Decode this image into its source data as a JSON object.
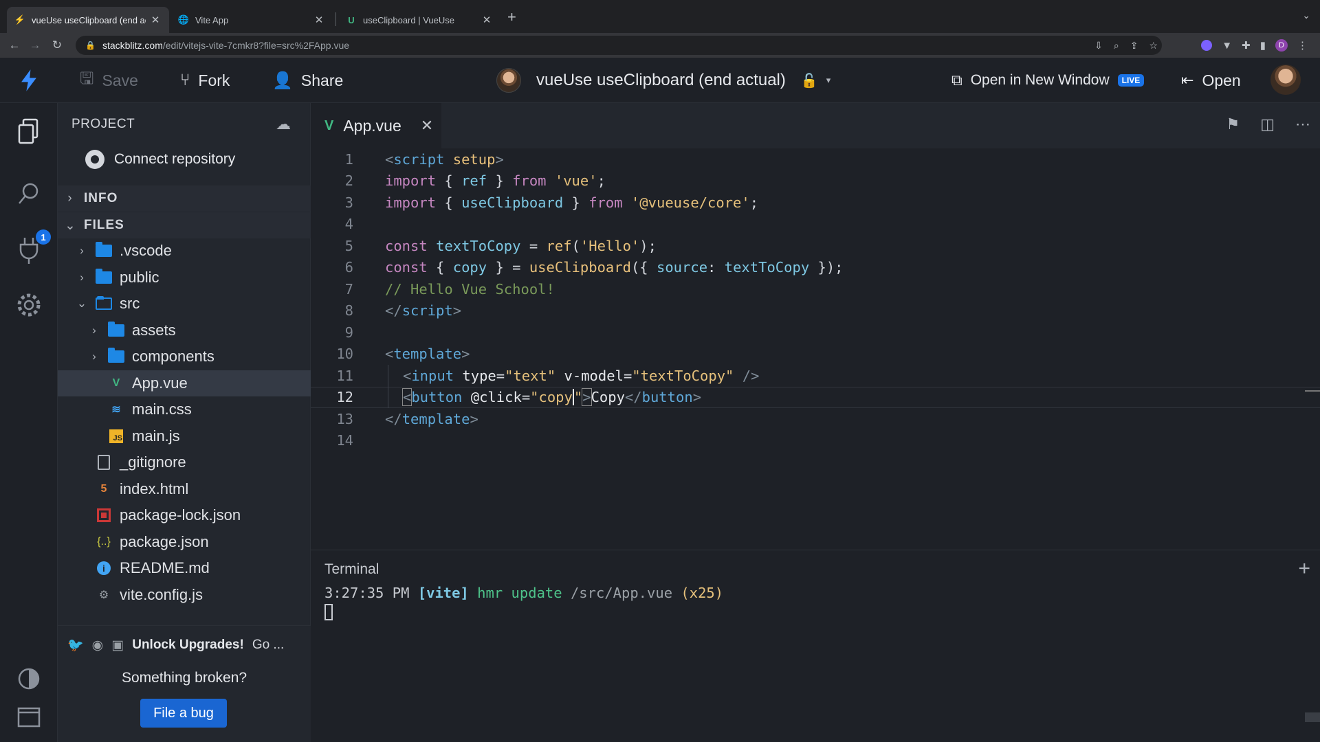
{
  "browser": {
    "tabs": [
      {
        "title": "vueUse useClipboard (end actual)",
        "active": true,
        "favicon": "bolt-icon"
      },
      {
        "title": "Vite App",
        "active": false,
        "favicon": "globe-icon"
      },
      {
        "title": "useClipboard | VueUse",
        "active": false,
        "favicon": "vueuse-icon"
      }
    ],
    "url_host": "stackblitz.com",
    "url_path": "/edit/vitejs-vite-7cmkr8?file=src%2FApp.vue",
    "profile_initial": "D"
  },
  "header": {
    "save_label": "Save",
    "fork_label": "Fork",
    "share_label": "Share",
    "project_title": "vueUse useClipboard (end actual)",
    "open_new_window_label": "Open in New Window",
    "live_badge": "LIVE",
    "open_label": "Open"
  },
  "activity": {
    "badge_count": "1"
  },
  "sidebar": {
    "project_label": "PROJECT",
    "connect_label": "Connect repository",
    "info_label": "INFO",
    "files_label": "FILES",
    "tree": [
      {
        "name": ".vscode",
        "type": "folder",
        "depth": 1,
        "state": "collapsed"
      },
      {
        "name": "public",
        "type": "folder",
        "depth": 1,
        "state": "collapsed"
      },
      {
        "name": "src",
        "type": "folder",
        "depth": 1,
        "state": "expanded"
      },
      {
        "name": "assets",
        "type": "folder",
        "depth": 2,
        "state": "collapsed"
      },
      {
        "name": "components",
        "type": "folder",
        "depth": 2,
        "state": "collapsed"
      },
      {
        "name": "App.vue",
        "type": "vue",
        "depth": 2,
        "selected": true
      },
      {
        "name": "main.css",
        "type": "css",
        "depth": 2
      },
      {
        "name": "main.js",
        "type": "js",
        "depth": 2
      },
      {
        "name": "_gitignore",
        "type": "file",
        "depth": 1
      },
      {
        "name": "index.html",
        "type": "html",
        "depth": 1
      },
      {
        "name": "package-lock.json",
        "type": "npm",
        "depth": 1
      },
      {
        "name": "package.json",
        "type": "json",
        "depth": 1
      },
      {
        "name": "README.md",
        "type": "info",
        "depth": 1
      },
      {
        "name": "vite.config.js",
        "type": "gear",
        "depth": 1
      }
    ],
    "unlock_label": "Unlock Upgrades!",
    "unlock_rest": "Go ...",
    "broken_label": "Something broken?",
    "bug_label": "File a bug"
  },
  "editor": {
    "tab_label": "App.vue",
    "current_line": 12,
    "line_numbers": [
      "1",
      "2",
      "3",
      "4",
      "5",
      "6",
      "7",
      "8",
      "9",
      "10",
      "11",
      "12",
      "13",
      "14"
    ]
  },
  "terminal": {
    "title": "Terminal",
    "time": "3:27:35 PM",
    "tag": "[vite]",
    "action": "hmr update",
    "path": "/src/App.vue",
    "count": "(x25)"
  },
  "colors": {
    "accent": "#1a73e8",
    "vue_green": "#41b883",
    "folder_blue": "#1e88e5"
  }
}
